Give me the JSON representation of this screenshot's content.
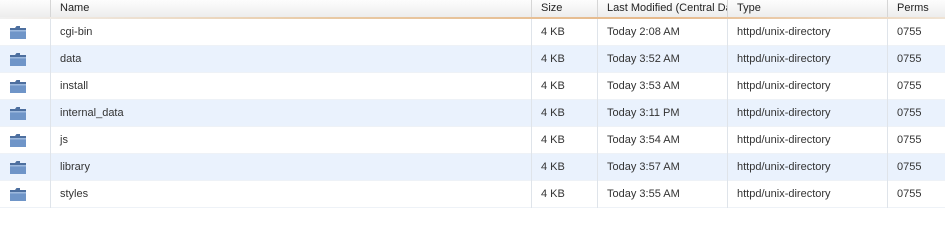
{
  "columns": {
    "icon": "",
    "name": "Name",
    "size": "Size",
    "modified": "Last Modified (Central Da",
    "type": "Type",
    "perms": "Perms"
  },
  "rows": [
    {
      "name": "cgi-bin",
      "size": "4 KB",
      "modified": "Today 2:08 AM",
      "type": "httpd/unix-directory",
      "perms": "0755",
      "icon": "folder-icon"
    },
    {
      "name": "data",
      "size": "4 KB",
      "modified": "Today 3:52 AM",
      "type": "httpd/unix-directory",
      "perms": "0755",
      "icon": "folder-icon"
    },
    {
      "name": "install",
      "size": "4 KB",
      "modified": "Today 3:53 AM",
      "type": "httpd/unix-directory",
      "perms": "0755",
      "icon": "folder-icon"
    },
    {
      "name": "internal_data",
      "size": "4 KB",
      "modified": "Today 3:11 PM",
      "type": "httpd/unix-directory",
      "perms": "0755",
      "icon": "folder-icon"
    },
    {
      "name": "js",
      "size": "4 KB",
      "modified": "Today 3:54 AM",
      "type": "httpd/unix-directory",
      "perms": "0755",
      "icon": "folder-icon"
    },
    {
      "name": "library",
      "size": "4 KB",
      "modified": "Today 3:57 AM",
      "type": "httpd/unix-directory",
      "perms": "0755",
      "icon": "folder-icon"
    },
    {
      "name": "styles",
      "size": "4 KB",
      "modified": "Today 3:55 AM",
      "type": "httpd/unix-directory",
      "perms": "0755",
      "icon": "folder-icon"
    }
  ],
  "colors": {
    "row_alt": "#eaf2fd",
    "folder": "#5b7fb2"
  }
}
